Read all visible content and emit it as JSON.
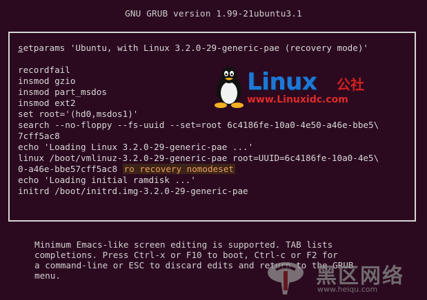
{
  "header": {
    "title": "GNU GRUB  version 1.99-21ubuntu3.1"
  },
  "editor": {
    "first_line_cursor_char": "s",
    "first_line_rest": "etparams 'Ubuntu, with Linux 3.2.0-29-generic-pae (recovery mode)'",
    "lines": [
      "recordfail",
      "insmod gzio",
      "insmod part_msdos",
      "insmod ext2",
      "set root='(hd0,msdos1)'",
      "search --no-floppy --fs-uuid --set=root 6c4186fe-10a0-4e50-a46e-bbe5\\",
      "7cff5ac8",
      "echo 'Loading Linux 3.2.0-29-generic-pae ...'",
      "linux /boot/vmlinuz-3.2.0-29-generic-pae root=UUID=6c4186fe-10a0-4e5\\",
      "0-a46e-bbe57cff5ac8",
      "echo 'Loading initial ramdisk ...'",
      "initrd /boot/initrd.img-3.2.0-29-generic-pae"
    ],
    "highlight_text": "ro recovery nomodeset"
  },
  "help": {
    "lines": [
      "Minimum Emacs-like screen editing is supported. TAB lists",
      "completions. Press Ctrl-x or F10 to boot, Ctrl-c or F2 for",
      "a command-line or ESC to discard edits and return to the GRUB",
      "menu."
    ]
  },
  "watermark_logo": {
    "text": "Linux",
    "cn": "公社",
    "url": "www.Linuxidc.com",
    "colors": {
      "blue": "#1e78d6",
      "red": "#d42020"
    }
  },
  "watermark_bottom": {
    "cn": "黑区网络",
    "url": "www.heiqu.com"
  }
}
